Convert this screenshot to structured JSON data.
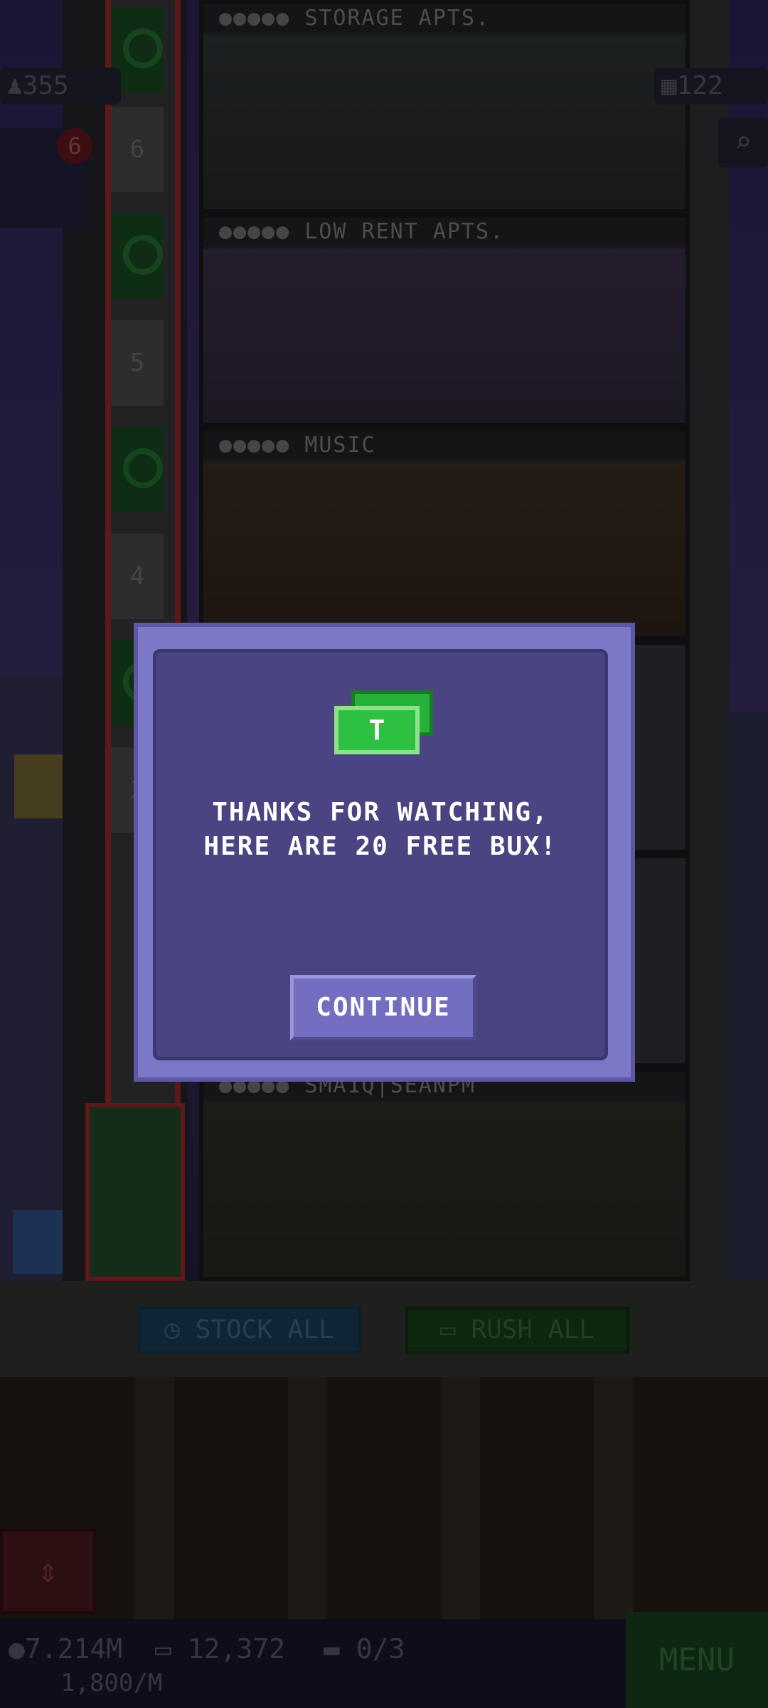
{
  "hud": {
    "population": "355",
    "floors": "122",
    "notification_count": "6"
  },
  "tower": {
    "floor_labels": [
      {
        "dots": "●●●●●",
        "name": "STORAGE APTS."
      },
      {
        "dots": "●●●●●",
        "name": "LOW RENT APTS."
      },
      {
        "dots": "●●●●●",
        "name": "MUSIC"
      },
      {
        "dots": "●●●●●",
        "name": "SMA1Q|SEANPM"
      }
    ],
    "elevator_numbers": [
      "6",
      "5",
      "4",
      "3"
    ]
  },
  "actions": {
    "stock_all": "STOCK ALL",
    "rush_all": "RUSH ALL"
  },
  "footer": {
    "coins": "7.214M",
    "bux": "12,372",
    "tickets": "0/3",
    "income_rate": "1,800/M",
    "menu": "MENU"
  },
  "dialog": {
    "line1": "THANKS FOR WATCHING,",
    "line2": "HERE ARE 20 FREE BUX!",
    "continue_label": "CONTINUE"
  },
  "colors": {
    "dialog_bg": "#4a4582",
    "dialog_frame": "#7d77c8",
    "bux_green": "#2ec040"
  }
}
